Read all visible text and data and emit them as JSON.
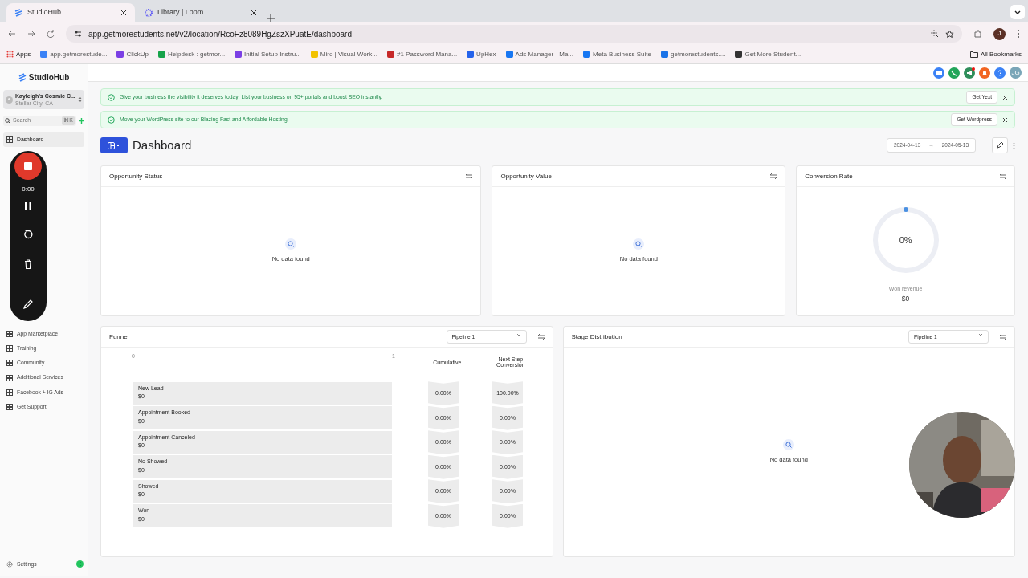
{
  "browser": {
    "tabs": [
      {
        "title": "StudioHub",
        "selected": true
      },
      {
        "title": "Library | Loom",
        "selected": false
      }
    ],
    "url": "app.getmorestudents.net/v2/location/RcoFz8089HgZszXPuatE/dashboard",
    "bookmarks": [
      "Apps",
      "app.getmorestude...",
      "ClickUp",
      "Helpdesk : getmor...",
      "Initial Setup Instru...",
      "Miro | Visual Work...",
      "#1 Password Mana...",
      "UpHex",
      "Ads Manager - Ma...",
      "Meta Business Suite",
      "getmorestudents....",
      "Get More Student..."
    ],
    "all_bookmarks": "All Bookmarks",
    "profile_initial": "J"
  },
  "header": {
    "avatar": "JG"
  },
  "sidebar": {
    "logo": "StudioHub",
    "account": {
      "name": "Kayleigh's Cosmic C...",
      "location": "Stellar City, CA"
    },
    "search": {
      "placeholder": "Search",
      "shortcut": "⌘K"
    },
    "top_items": [
      {
        "label": "Dashboard",
        "selected": true
      }
    ],
    "items": [
      {
        "label": "App Marketplace",
        "selected": false
      },
      {
        "label": "Training",
        "selected": false
      },
      {
        "label": "Community",
        "selected": false
      },
      {
        "label": "Additional Services",
        "selected": false
      },
      {
        "label": "Facebook + IG Ads",
        "selected": false
      },
      {
        "label": "Get Support",
        "selected": false
      }
    ],
    "settings": "Settings"
  },
  "banners": [
    {
      "text": "Give your business the visibility it deserves today! List your business on 95+ portals and boost SEO instantly.",
      "button": "Get Yext"
    },
    {
      "text": "Move your WordPress site to our Blazing Fast and Affordable Hosting.",
      "button": "Get Wordpress"
    }
  ],
  "page": {
    "title": "Dashboard",
    "date_from": "2024-04-13",
    "date_arrow": "→",
    "date_to": "2024-05-13"
  },
  "cards": [
    {
      "title": "Opportunity Status",
      "kind": "empty",
      "message": "No data found"
    },
    {
      "title": "Opportunity Value",
      "kind": "empty",
      "message": "No data found"
    },
    {
      "title": "Conversion Rate",
      "kind": "gauge",
      "value": "0%",
      "caption": "Won revenue",
      "amount": "$0"
    }
  ],
  "funnel": {
    "title": "Funnel",
    "pipeline": "Pipeline 1",
    "axis_min": "0",
    "axis_max": "1",
    "col_cumulative": "Cumulative",
    "col_next": "Next Step Conversion",
    "rows": [
      {
        "stage": "New Lead",
        "value": "$0",
        "cumulative": "0.00%",
        "next": "100.00%"
      },
      {
        "stage": "Appointment Booked",
        "value": "$0",
        "cumulative": "0.00%",
        "next": "0.00%"
      },
      {
        "stage": "Appointment Canceled",
        "value": "$0",
        "cumulative": "0.00%",
        "next": "0.00%"
      },
      {
        "stage": "No Showed",
        "value": "$0",
        "cumulative": "0.00%",
        "next": "0.00%"
      },
      {
        "stage": "Showed",
        "value": "$0",
        "cumulative": "0.00%",
        "next": "0.00%"
      },
      {
        "stage": "Won",
        "value": "$0",
        "cumulative": "0.00%",
        "next": "0.00%"
      }
    ]
  },
  "stage_distribution": {
    "title": "Stage Distribution",
    "pipeline": "Pipeline 1",
    "message": "No data found"
  },
  "recorder": {
    "time": "0:00"
  }
}
